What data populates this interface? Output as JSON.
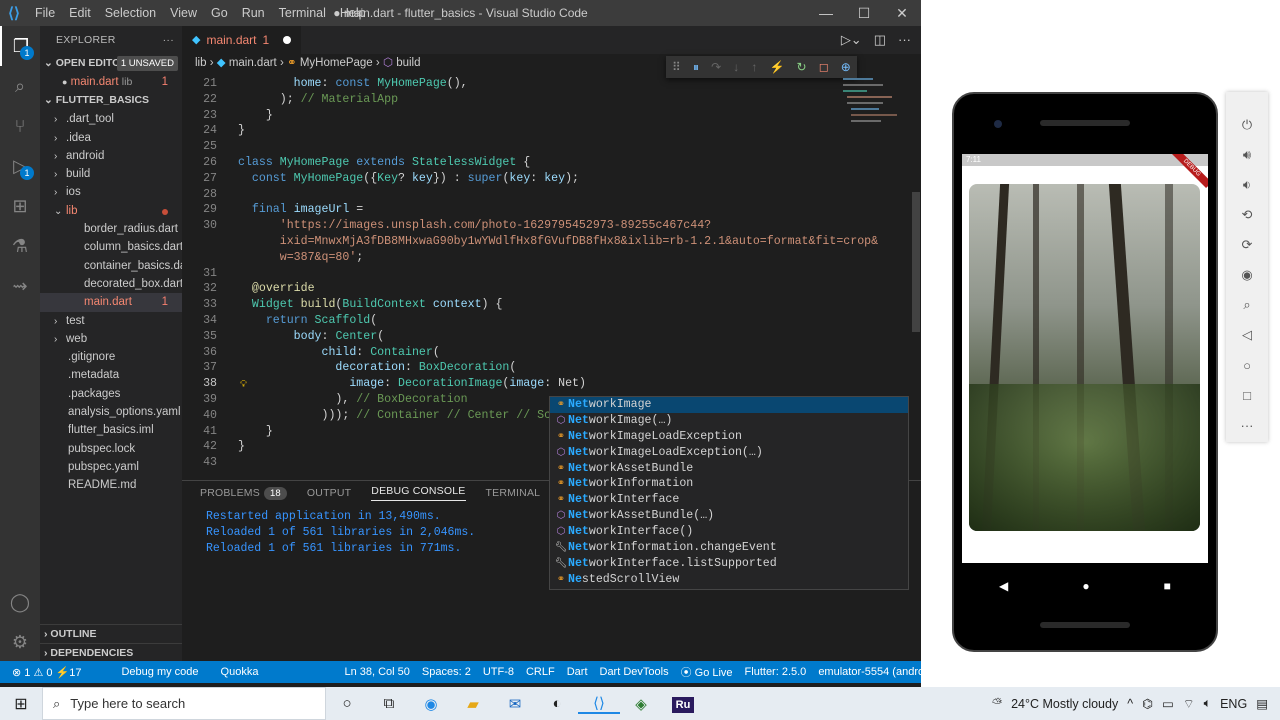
{
  "window": {
    "title": "● main.dart - flutter_basics - Visual Studio Code",
    "menu": [
      "File",
      "Edit",
      "Selection",
      "View",
      "Go",
      "Run",
      "Terminal",
      "Help"
    ],
    "controls": [
      "—",
      "☐",
      "✕"
    ]
  },
  "activity": {
    "explorer_badge": "1",
    "debug_badge": "1"
  },
  "sidebar": {
    "title": "EXPLORER",
    "open_editors_label": "OPEN EDITORS",
    "unsaved": "1 UNSAVED",
    "open_file": "main.dart",
    "open_file_dir": "lib",
    "open_file_count": "1",
    "project": "FLUTTER_BASICS",
    "items": [
      {
        "label": ".dart_tool",
        "type": "folder"
      },
      {
        "label": ".idea",
        "type": "folder"
      },
      {
        "label": "android",
        "type": "folder"
      },
      {
        "label": "build",
        "type": "folder"
      },
      {
        "label": "ios",
        "type": "folder"
      },
      {
        "label": "lib",
        "type": "folder-open"
      },
      {
        "label": "border_radius.dart",
        "type": "dart"
      },
      {
        "label": "column_basics.dart",
        "type": "dart"
      },
      {
        "label": "container_basics.dart",
        "type": "dart"
      },
      {
        "label": "decorated_box.dart",
        "type": "dart"
      },
      {
        "label": "main.dart",
        "type": "dart",
        "count": "1"
      },
      {
        "label": "test",
        "type": "folder"
      },
      {
        "label": "web",
        "type": "folder"
      },
      {
        "label": ".gitignore",
        "type": "file"
      },
      {
        "label": ".metadata",
        "type": "file"
      },
      {
        "label": ".packages",
        "type": "file"
      },
      {
        "label": "analysis_options.yaml",
        "type": "file"
      },
      {
        "label": "flutter_basics.iml",
        "type": "file"
      },
      {
        "label": "pubspec.lock",
        "type": "file"
      },
      {
        "label": "pubspec.yaml",
        "type": "file"
      },
      {
        "label": "README.md",
        "type": "file"
      }
    ],
    "outline": "OUTLINE",
    "dependencies": "DEPENDENCIES"
  },
  "editor": {
    "tab_label": "main.dart",
    "tab_count": "1",
    "breadcrumb": [
      "lib",
      "main.dart",
      "MyHomePage",
      "build"
    ],
    "lines": [
      {
        "n": "21",
        "parts": [
          [
            "pl",
            "        "
          ],
          [
            "var",
            "home"
          ],
          [
            "pl",
            ": "
          ],
          [
            "kw",
            "const "
          ],
          [
            "ty",
            "MyHomePage"
          ],
          [
            "pl",
            "(),"
          ]
        ]
      },
      {
        "n": "22",
        "parts": [
          [
            "pl",
            "      ); "
          ],
          [
            "cm",
            "// MaterialApp"
          ]
        ]
      },
      {
        "n": "23",
        "parts": [
          [
            "pl",
            "    }"
          ]
        ]
      },
      {
        "n": "24",
        "parts": [
          [
            "pl",
            "}"
          ]
        ]
      },
      {
        "n": "25",
        "parts": [
          [
            "pl",
            ""
          ]
        ]
      },
      {
        "n": "26",
        "parts": [
          [
            "kw",
            "class "
          ],
          [
            "ty",
            "MyHomePage "
          ],
          [
            "kw",
            "extends "
          ],
          [
            "ty",
            "StatelessWidget "
          ],
          [
            "pl",
            "{"
          ]
        ]
      },
      {
        "n": "27",
        "parts": [
          [
            "pl",
            "  "
          ],
          [
            "kw",
            "const "
          ],
          [
            "ty",
            "MyHomePage"
          ],
          [
            "pl",
            "({"
          ],
          [
            "ty",
            "Key"
          ],
          [
            "pl",
            "? "
          ],
          [
            "var",
            "key"
          ],
          [
            "pl",
            "}) : "
          ],
          [
            "kw",
            "super"
          ],
          [
            "pl",
            "("
          ],
          [
            "var",
            "key"
          ],
          [
            "pl",
            ": "
          ],
          [
            "var",
            "key"
          ],
          [
            "pl",
            ");"
          ]
        ]
      },
      {
        "n": "28",
        "parts": [
          [
            "pl",
            ""
          ]
        ]
      },
      {
        "n": "29",
        "parts": [
          [
            "pl",
            "  "
          ],
          [
            "kw",
            "final "
          ],
          [
            "var",
            "imageUrl "
          ],
          [
            "pl",
            "="
          ]
        ]
      },
      {
        "n": "30",
        "parts": [
          [
            "pl",
            "      "
          ],
          [
            "st",
            "'https://images.unsplash.com/photo-1629795452973-89255c467c44?"
          ]
        ]
      },
      {
        "n": "",
        "parts": [
          [
            "pl",
            "      "
          ],
          [
            "st",
            "ixid=MnwxMjA3fDB8MHxwaG90by1wYWdlfHx8fGVufDB8fHx8&ixlib=rb-1.2.1&auto=format&fit=crop&"
          ]
        ]
      },
      {
        "n": "",
        "parts": [
          [
            "pl",
            "      "
          ],
          [
            "st",
            "w=387&q=80'"
          ],
          [
            "pl",
            ";"
          ]
        ]
      },
      {
        "n": "31",
        "parts": [
          [
            "pl",
            ""
          ]
        ]
      },
      {
        "n": "32",
        "parts": [
          [
            "pl",
            "  "
          ],
          [
            "fn",
            "@override"
          ]
        ]
      },
      {
        "n": "33",
        "parts": [
          [
            "pl",
            "  "
          ],
          [
            "ty",
            "Widget "
          ],
          [
            "fn",
            "build"
          ],
          [
            "pl",
            "("
          ],
          [
            "ty",
            "BuildContext "
          ],
          [
            "var",
            "context"
          ],
          [
            "pl",
            ") {"
          ]
        ]
      },
      {
        "n": "34",
        "parts": [
          [
            "pl",
            "    "
          ],
          [
            "kw",
            "return "
          ],
          [
            "ty",
            "Scaffold"
          ],
          [
            "pl",
            "("
          ]
        ]
      },
      {
        "n": "35",
        "parts": [
          [
            "pl",
            "        "
          ],
          [
            "var",
            "body"
          ],
          [
            "pl",
            ": "
          ],
          [
            "ty",
            "Center"
          ],
          [
            "pl",
            "("
          ]
        ]
      },
      {
        "n": "36",
        "parts": [
          [
            "pl",
            "            "
          ],
          [
            "var",
            "child"
          ],
          [
            "pl",
            ": "
          ],
          [
            "ty",
            "Container"
          ],
          [
            "pl",
            "("
          ]
        ]
      },
      {
        "n": "37",
        "parts": [
          [
            "pl",
            "              "
          ],
          [
            "var",
            "decoration"
          ],
          [
            "pl",
            ": "
          ],
          [
            "ty",
            "BoxDecoration"
          ],
          [
            "pl",
            "("
          ]
        ]
      },
      {
        "n": "38",
        "parts": [
          [
            "pl",
            "                "
          ],
          [
            "var",
            "image"
          ],
          [
            "pl",
            ": "
          ],
          [
            "ty",
            "DecorationImage"
          ],
          [
            "pl",
            "("
          ],
          [
            "var",
            "image"
          ],
          [
            "pl",
            ": "
          ],
          [
            "pl",
            "Net)"
          ]
        ],
        "current": true
      },
      {
        "n": "39",
        "parts": [
          [
            "pl",
            "              ), "
          ],
          [
            "cm",
            "// BoxDecoration"
          ]
        ]
      },
      {
        "n": "40",
        "parts": [
          [
            "pl",
            "            ))); "
          ],
          [
            "cm",
            "// Container // Center // Scaff"
          ]
        ]
      },
      {
        "n": "41",
        "parts": [
          [
            "pl",
            "    }"
          ]
        ]
      },
      {
        "n": "42",
        "parts": [
          [
            "pl",
            "}"
          ]
        ]
      },
      {
        "n": "43",
        "parts": [
          [
            "pl",
            ""
          ]
        ]
      }
    ]
  },
  "suggest": {
    "typed": "Net",
    "items": [
      {
        "icon": "class",
        "prefix": "Net",
        "rest": "workImage"
      },
      {
        "icon": "method",
        "prefix": "Net",
        "rest": "workImage(…)"
      },
      {
        "icon": "class",
        "prefix": "Net",
        "rest": "workImageLoadException"
      },
      {
        "icon": "method",
        "prefix": "Net",
        "rest": "workImageLoadException(…)"
      },
      {
        "icon": "class",
        "prefix": "Net",
        "rest": "workAssetBundle"
      },
      {
        "icon": "class",
        "prefix": "Net",
        "rest": "workInformation"
      },
      {
        "icon": "class",
        "prefix": "Net",
        "rest": "workInterface"
      },
      {
        "icon": "method",
        "prefix": "Net",
        "rest": "workAssetBundle(…)"
      },
      {
        "icon": "method",
        "prefix": "Net",
        "rest": "workInterface()"
      },
      {
        "icon": "property",
        "prefix": "Net",
        "rest": "workInformation.changeEvent"
      },
      {
        "icon": "property",
        "prefix": "Net",
        "rest": "workInterface.listSupported"
      },
      {
        "icon": "class",
        "prefix": "Ne",
        "rest": "stedScrollView"
      }
    ]
  },
  "panel": {
    "tabs": [
      "PROBLEMS",
      "OUTPUT",
      "DEBUG CONSOLE",
      "TERMINAL"
    ],
    "problems_count": "18",
    "console": [
      "Restarted application in 13,490ms.",
      "Reloaded 1 of 561 libraries in 2,046ms.",
      "Reloaded 1 of 561 libraries in 771ms."
    ]
  },
  "statusbar": {
    "errors": "⊗ 1 ⚠ 0 ⚡17",
    "debug": "Debug my code",
    "quokka": "Quokka",
    "position": "Ln 38, Col 50",
    "spaces": "Spaces: 2",
    "encoding": "UTF-8",
    "eol": "CRLF",
    "language": "Dart",
    "devtools": "Dart DevTools",
    "golive": "⦿ Go Live",
    "flutter": "Flutter: 2.5.0",
    "device": "emulator-5554 (android-arm)"
  },
  "phone": {
    "time": "7:11",
    "ribbon": "DEBUG"
  },
  "taskbar": {
    "search_placeholder": "Type here to search",
    "weather": "24°C  Mostly cloudy",
    "lang": "ENG",
    "app_label": "Ru"
  }
}
